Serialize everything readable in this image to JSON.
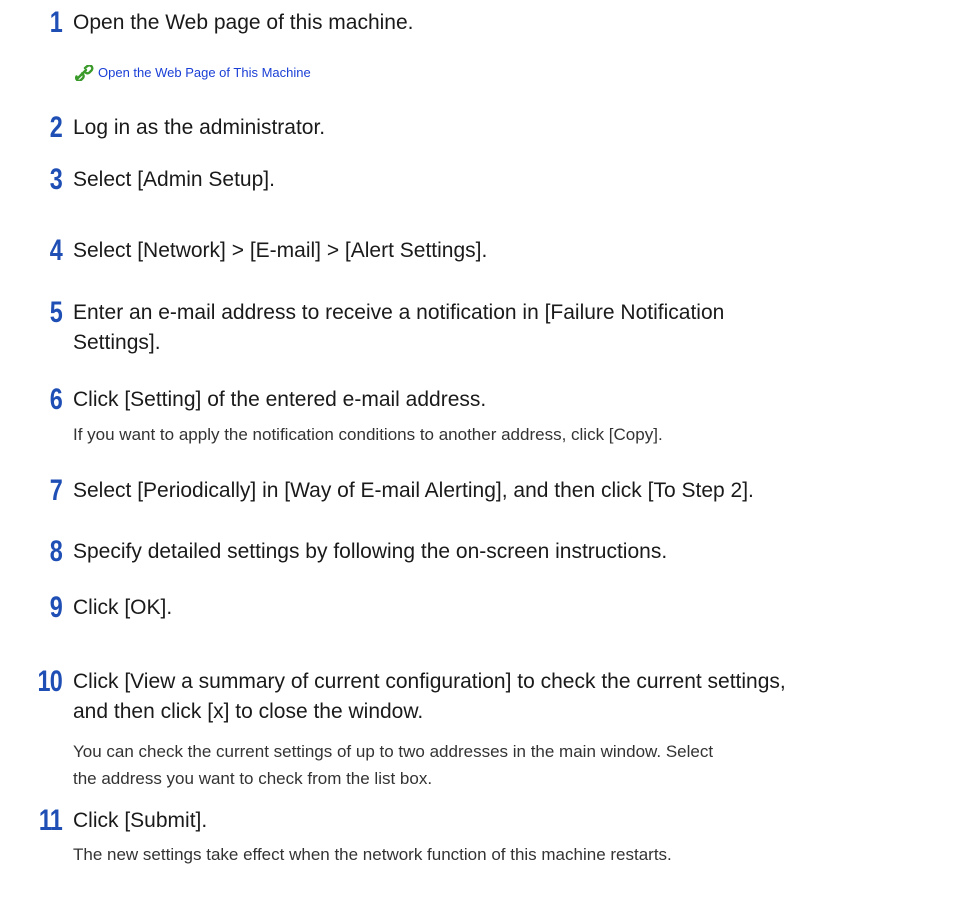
{
  "steps": [
    {
      "number": "1",
      "text": "Open the Web page of this machine."
    },
    {
      "number": "2",
      "text": "Log in as the administrator."
    },
    {
      "number": "3",
      "text": "Select [Admin Setup]."
    },
    {
      "number": "4",
      "text": "Select [Network] > [E-mail] > [Alert Settings]."
    },
    {
      "number": "5",
      "text_line1": "Enter an e-mail address to receive a notification in [Failure Notification",
      "text_line2": "Settings]."
    },
    {
      "number": "6",
      "text": "Click [Setting] of the entered e-mail address.",
      "note": "If you want to apply the notification conditions to another address, click [Copy]."
    },
    {
      "number": "7",
      "text": "Select [Periodically] in [Way of E-mail Alerting], and then click [To Step 2]."
    },
    {
      "number": "8",
      "text": "Specify detailed settings by following the on-screen instructions."
    },
    {
      "number": "9",
      "text": "Click [OK]."
    },
    {
      "number": "10",
      "text_line1": "Click [View a summary of current configuration] to check the current settings,",
      "text_line2": "and then click [x] to close the window.",
      "note_line1": "You can check the current settings of up to two addresses in the main window. Select",
      "note_line2": "the address you want to check from the list box."
    },
    {
      "number": "11",
      "text": "Click [Submit].",
      "note": "The new settings take effect when the network function of this machine restarts."
    }
  ],
  "link": {
    "label": "Open the Web Page of This Machine",
    "icon": "link-chain-icon"
  },
  "colors": {
    "step_number": "#1f4fb5",
    "link": "#1a3fd6",
    "link_icon": "#3a9a2a"
  }
}
